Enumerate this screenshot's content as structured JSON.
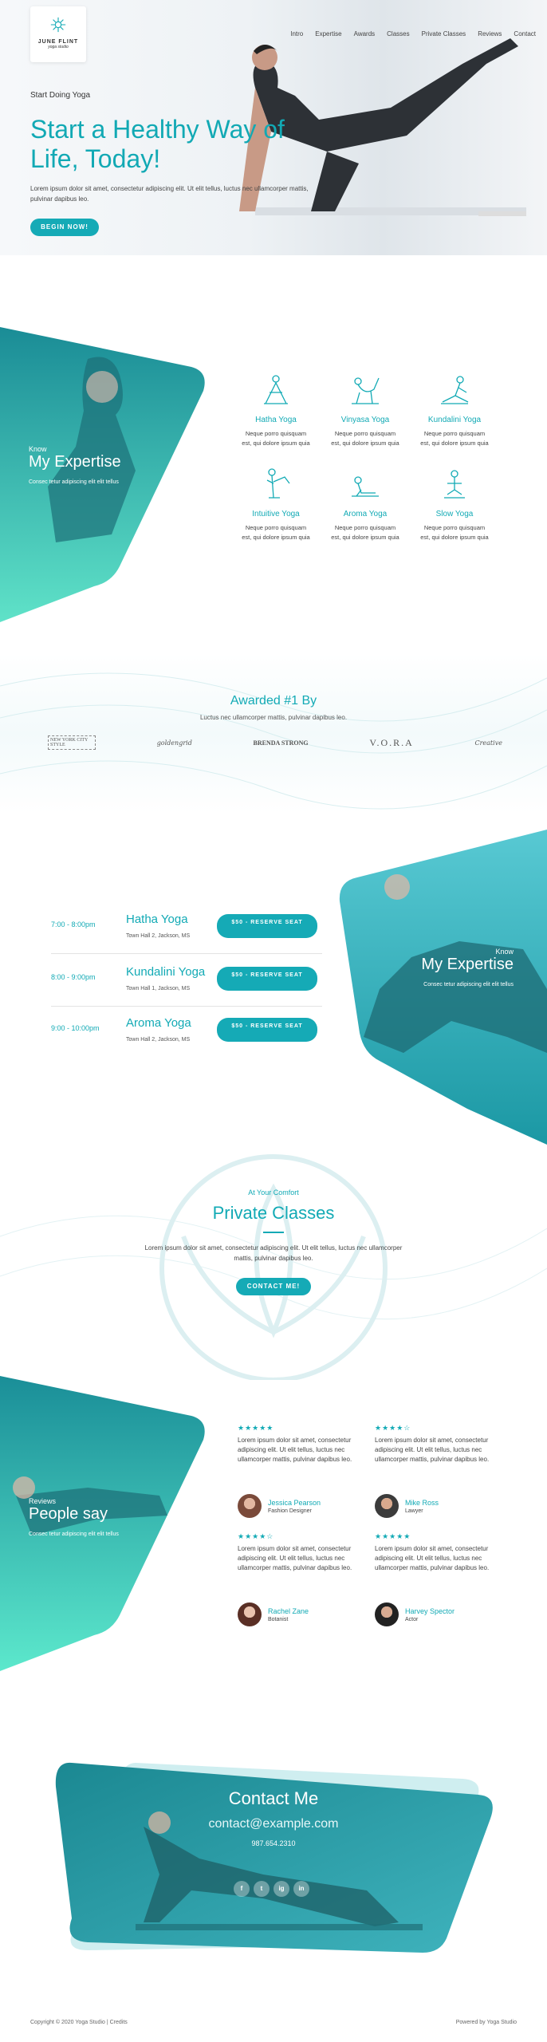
{
  "brand": {
    "name": "JUNE FLINT",
    "tagline": "yoga studio"
  },
  "nav": [
    "Intro",
    "Expertise",
    "Awards",
    "Classes",
    "Private Classes",
    "Reviews",
    "Contact"
  ],
  "hero": {
    "kicker": "Start Doing Yoga",
    "title": "Start a Healthy Way of Life, Today!",
    "desc": "Lorem ipsum dolor sit amet, consectetur adipiscing elit. Ut elit tellus, luctus nec ullamcorper mattis, pulvinar dapibus leo.",
    "button": "BEGIN NOW!"
  },
  "expertise": {
    "kicker": "Know",
    "title": "My Expertise",
    "sub": "Consec tetur adipiscing elit elit tellus",
    "items": [
      {
        "title": "Hatha Yoga",
        "desc": "Neque porro quisquam est, qui dolore ipsum quia"
      },
      {
        "title": "Vinyasa Yoga",
        "desc": "Neque porro quisquam est, qui dolore ipsum quia"
      },
      {
        "title": "Kundalini Yoga",
        "desc": "Neque porro quisquam est, qui dolore ipsum quia"
      },
      {
        "title": "Intuitive Yoga",
        "desc": "Neque porro quisquam est, qui dolore ipsum quia"
      },
      {
        "title": "Aroma Yoga",
        "desc": "Neque porro quisquam est, qui dolore ipsum quia"
      },
      {
        "title": "Slow Yoga",
        "desc": "Neque porro quisquam est, qui dolore ipsum quia"
      }
    ]
  },
  "awards": {
    "title": "Awarded #1 By",
    "sub": "Luctus nec ullamcorper mattis, pulvinar dapibus leo.",
    "logos": [
      "NEW YORK CITY STYLE",
      "goldengrid",
      "BRENDA STRONG",
      "V.O.R.A",
      "Creative"
    ]
  },
  "schedule": {
    "kicker": "Know",
    "title": "My Expertise",
    "sub": "Consec tetur adipiscing elit elit tellus",
    "rows": [
      {
        "time": "7:00 - 8:00pm",
        "name": "Hatha Yoga",
        "loc": "Town Hall 2, Jackson, MS",
        "button": "$50 - RESERVE SEAT"
      },
      {
        "time": "8:00 - 9:00pm",
        "name": "Kundalini Yoga",
        "loc": "Town Hall 1, Jackson, MS",
        "button": "$50 - RESERVE SEAT"
      },
      {
        "time": "9:00 - 10:00pm",
        "name": "Aroma Yoga",
        "loc": "Town Hall 2, Jackson, MS",
        "button": "$50 - RESERVE SEAT"
      }
    ]
  },
  "private": {
    "kicker": "At Your Comfort",
    "title": "Private Classes",
    "desc": "Lorem ipsum dolor sit amet, consectetur adipiscing elit. Ut elit tellus, luctus nec ullamcorper mattis, pulvinar dapibus leo.",
    "button": "CONTACT ME!"
  },
  "reviews": {
    "kicker": "Reviews",
    "title": "People say",
    "sub": "Consec tetur adipiscing elit elit tellus",
    "items": [
      {
        "stars": "★★★★★",
        "text": "Lorem ipsum dolor sit amet, consectetur adipiscing elit. Ut elit tellus, luctus nec ullamcorper mattis, pulvinar dapibus leo.",
        "name": "Jessica Pearson",
        "role": "Fashion Designer"
      },
      {
        "stars": "★★★★☆",
        "text": "Lorem ipsum dolor sit amet, consectetur adipiscing elit. Ut elit tellus, luctus nec ullamcorper mattis, pulvinar dapibus leo.",
        "name": "Mike Ross",
        "role": "Lawyer"
      },
      {
        "stars": "★★★★☆",
        "text": "Lorem ipsum dolor sit amet, consectetur adipiscing elit. Ut elit tellus, luctus nec ullamcorper mattis, pulvinar dapibus leo.",
        "name": "Rachel Zane",
        "role": "Botanist"
      },
      {
        "stars": "★★★★★",
        "text": "Lorem ipsum dolor sit amet, consectetur adipiscing elit. Ut elit tellus, luctus nec ullamcorper mattis, pulvinar dapibus leo.",
        "name": "Harvey Spector",
        "role": "Actor"
      }
    ]
  },
  "contact": {
    "title": "Contact Me",
    "email": "contact@example.com",
    "phone": "987.654.2310",
    "socials": [
      "f",
      "t",
      "ig",
      "in"
    ]
  },
  "footer": {
    "copyright": "Copyright © 2020 Yoga Studio | Credits",
    "powered": "Powered by Yoga Studio"
  },
  "colors": {
    "accent": "#15aab6",
    "teal_dark": "#1b8f99",
    "mint": "#5ee6c8"
  }
}
